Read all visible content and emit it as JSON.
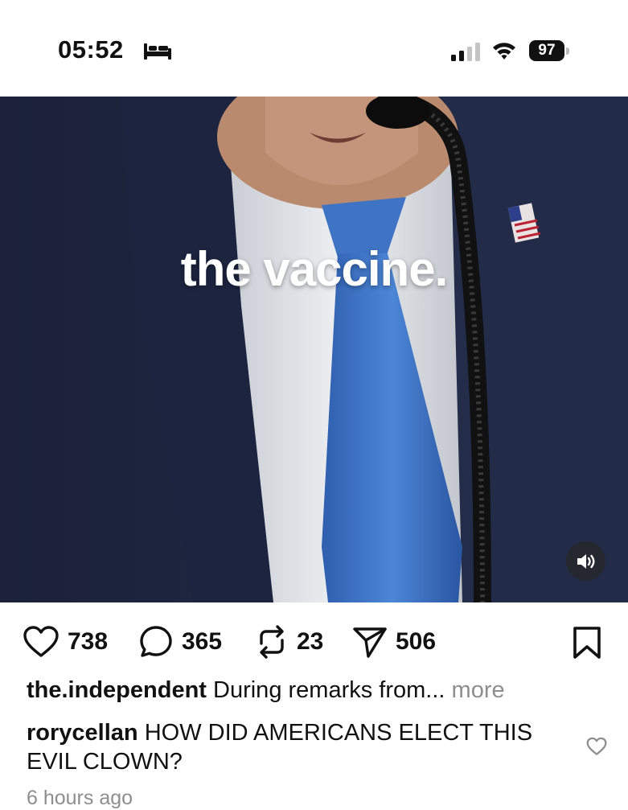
{
  "status_bar": {
    "time": "05:52",
    "battery": "97",
    "icons": [
      "bed-icon",
      "cellular-signal-icon",
      "wifi-icon",
      "battery-icon"
    ]
  },
  "video": {
    "caption": "the vaccine.",
    "sound_icon": "speaker-icon"
  },
  "actions": {
    "likes": "738",
    "comments": "365",
    "reposts": "23",
    "shares": "506",
    "icons": [
      "heart-icon",
      "comment-icon",
      "repost-icon",
      "send-icon",
      "bookmark-icon"
    ]
  },
  "post": {
    "username": "the.independent",
    "caption": "During remarks from...",
    "more_label": "more"
  },
  "top_comment": {
    "username": "rorycellan",
    "text": "HOW DID AMERICANS ELECT THIS EVIL CLOWN?"
  },
  "timestamp": "6 hours ago"
}
